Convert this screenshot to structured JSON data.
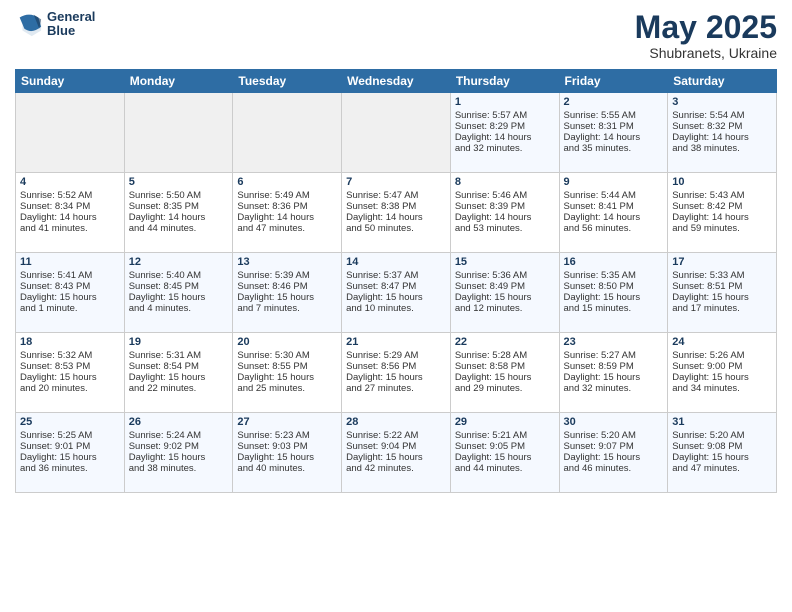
{
  "logo": {
    "line1": "General",
    "line2": "Blue"
  },
  "title": "May 2025",
  "subtitle": "Shubranets, Ukraine",
  "days_of_week": [
    "Sunday",
    "Monday",
    "Tuesday",
    "Wednesday",
    "Thursday",
    "Friday",
    "Saturday"
  ],
  "weeks": [
    [
      {
        "day": "",
        "info": ""
      },
      {
        "day": "",
        "info": ""
      },
      {
        "day": "",
        "info": ""
      },
      {
        "day": "",
        "info": ""
      },
      {
        "day": "1",
        "info": "Sunrise: 5:57 AM\nSunset: 8:29 PM\nDaylight: 14 hours\nand 32 minutes."
      },
      {
        "day": "2",
        "info": "Sunrise: 5:55 AM\nSunset: 8:31 PM\nDaylight: 14 hours\nand 35 minutes."
      },
      {
        "day": "3",
        "info": "Sunrise: 5:54 AM\nSunset: 8:32 PM\nDaylight: 14 hours\nand 38 minutes."
      }
    ],
    [
      {
        "day": "4",
        "info": "Sunrise: 5:52 AM\nSunset: 8:34 PM\nDaylight: 14 hours\nand 41 minutes."
      },
      {
        "day": "5",
        "info": "Sunrise: 5:50 AM\nSunset: 8:35 PM\nDaylight: 14 hours\nand 44 minutes."
      },
      {
        "day": "6",
        "info": "Sunrise: 5:49 AM\nSunset: 8:36 PM\nDaylight: 14 hours\nand 47 minutes."
      },
      {
        "day": "7",
        "info": "Sunrise: 5:47 AM\nSunset: 8:38 PM\nDaylight: 14 hours\nand 50 minutes."
      },
      {
        "day": "8",
        "info": "Sunrise: 5:46 AM\nSunset: 8:39 PM\nDaylight: 14 hours\nand 53 minutes."
      },
      {
        "day": "9",
        "info": "Sunrise: 5:44 AM\nSunset: 8:41 PM\nDaylight: 14 hours\nand 56 minutes."
      },
      {
        "day": "10",
        "info": "Sunrise: 5:43 AM\nSunset: 8:42 PM\nDaylight: 14 hours\nand 59 minutes."
      }
    ],
    [
      {
        "day": "11",
        "info": "Sunrise: 5:41 AM\nSunset: 8:43 PM\nDaylight: 15 hours\nand 1 minute."
      },
      {
        "day": "12",
        "info": "Sunrise: 5:40 AM\nSunset: 8:45 PM\nDaylight: 15 hours\nand 4 minutes."
      },
      {
        "day": "13",
        "info": "Sunrise: 5:39 AM\nSunset: 8:46 PM\nDaylight: 15 hours\nand 7 minutes."
      },
      {
        "day": "14",
        "info": "Sunrise: 5:37 AM\nSunset: 8:47 PM\nDaylight: 15 hours\nand 10 minutes."
      },
      {
        "day": "15",
        "info": "Sunrise: 5:36 AM\nSunset: 8:49 PM\nDaylight: 15 hours\nand 12 minutes."
      },
      {
        "day": "16",
        "info": "Sunrise: 5:35 AM\nSunset: 8:50 PM\nDaylight: 15 hours\nand 15 minutes."
      },
      {
        "day": "17",
        "info": "Sunrise: 5:33 AM\nSunset: 8:51 PM\nDaylight: 15 hours\nand 17 minutes."
      }
    ],
    [
      {
        "day": "18",
        "info": "Sunrise: 5:32 AM\nSunset: 8:53 PM\nDaylight: 15 hours\nand 20 minutes."
      },
      {
        "day": "19",
        "info": "Sunrise: 5:31 AM\nSunset: 8:54 PM\nDaylight: 15 hours\nand 22 minutes."
      },
      {
        "day": "20",
        "info": "Sunrise: 5:30 AM\nSunset: 8:55 PM\nDaylight: 15 hours\nand 25 minutes."
      },
      {
        "day": "21",
        "info": "Sunrise: 5:29 AM\nSunset: 8:56 PM\nDaylight: 15 hours\nand 27 minutes."
      },
      {
        "day": "22",
        "info": "Sunrise: 5:28 AM\nSunset: 8:58 PM\nDaylight: 15 hours\nand 29 minutes."
      },
      {
        "day": "23",
        "info": "Sunrise: 5:27 AM\nSunset: 8:59 PM\nDaylight: 15 hours\nand 32 minutes."
      },
      {
        "day": "24",
        "info": "Sunrise: 5:26 AM\nSunset: 9:00 PM\nDaylight: 15 hours\nand 34 minutes."
      }
    ],
    [
      {
        "day": "25",
        "info": "Sunrise: 5:25 AM\nSunset: 9:01 PM\nDaylight: 15 hours\nand 36 minutes."
      },
      {
        "day": "26",
        "info": "Sunrise: 5:24 AM\nSunset: 9:02 PM\nDaylight: 15 hours\nand 38 minutes."
      },
      {
        "day": "27",
        "info": "Sunrise: 5:23 AM\nSunset: 9:03 PM\nDaylight: 15 hours\nand 40 minutes."
      },
      {
        "day": "28",
        "info": "Sunrise: 5:22 AM\nSunset: 9:04 PM\nDaylight: 15 hours\nand 42 minutes."
      },
      {
        "day": "29",
        "info": "Sunrise: 5:21 AM\nSunset: 9:05 PM\nDaylight: 15 hours\nand 44 minutes."
      },
      {
        "day": "30",
        "info": "Sunrise: 5:20 AM\nSunset: 9:07 PM\nDaylight: 15 hours\nand 46 minutes."
      },
      {
        "day": "31",
        "info": "Sunrise: 5:20 AM\nSunset: 9:08 PM\nDaylight: 15 hours\nand 47 minutes."
      }
    ]
  ]
}
